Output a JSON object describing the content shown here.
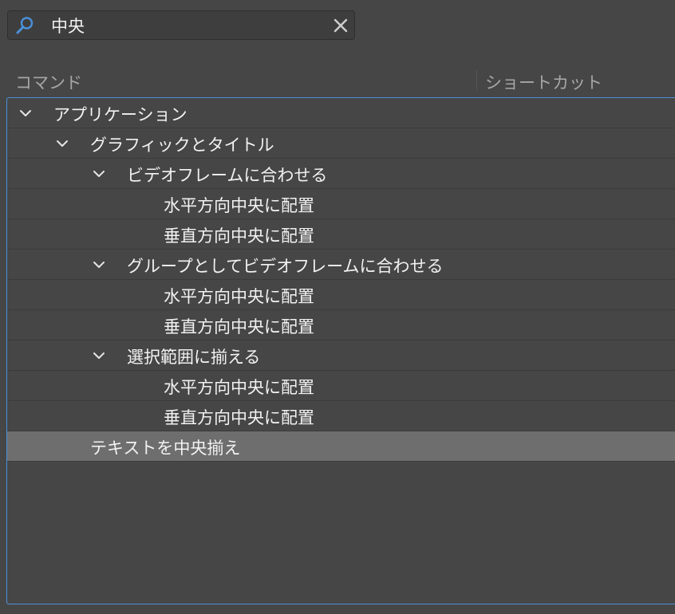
{
  "search": {
    "value": "中央",
    "icon": "search-icon",
    "clear_icon": "close-icon"
  },
  "columns": {
    "command": "コマンド",
    "shortcut": "ショートカット"
  },
  "tree": [
    {
      "label": "アプリケーション",
      "level": 0,
      "expanded": true
    },
    {
      "label": "グラフィックとタイトル",
      "level": 1,
      "expanded": true
    },
    {
      "label": "ビデオフレームに合わせる",
      "level": 2,
      "expanded": true
    },
    {
      "label": "水平方向中央に配置",
      "level": 3
    },
    {
      "label": "垂直方向中央に配置",
      "level": 3
    },
    {
      "label": "グループとしてビデオフレームに合わせる",
      "level": 2,
      "expanded": true
    },
    {
      "label": "水平方向中央に配置",
      "level": 3
    },
    {
      "label": "垂直方向中央に配置",
      "level": 3
    },
    {
      "label": "選択範囲に揃える",
      "level": 2,
      "expanded": true
    },
    {
      "label": "水平方向中央に配置",
      "level": 3
    },
    {
      "label": "垂直方向中央に配置",
      "level": 3
    },
    {
      "label": "テキストを中央揃え",
      "level": 1,
      "selected": true
    }
  ],
  "colors": {
    "background": "#464646",
    "selection": "#6e6e6e",
    "focus_border": "#4a90d9",
    "search_icon": "#4a90d9"
  }
}
